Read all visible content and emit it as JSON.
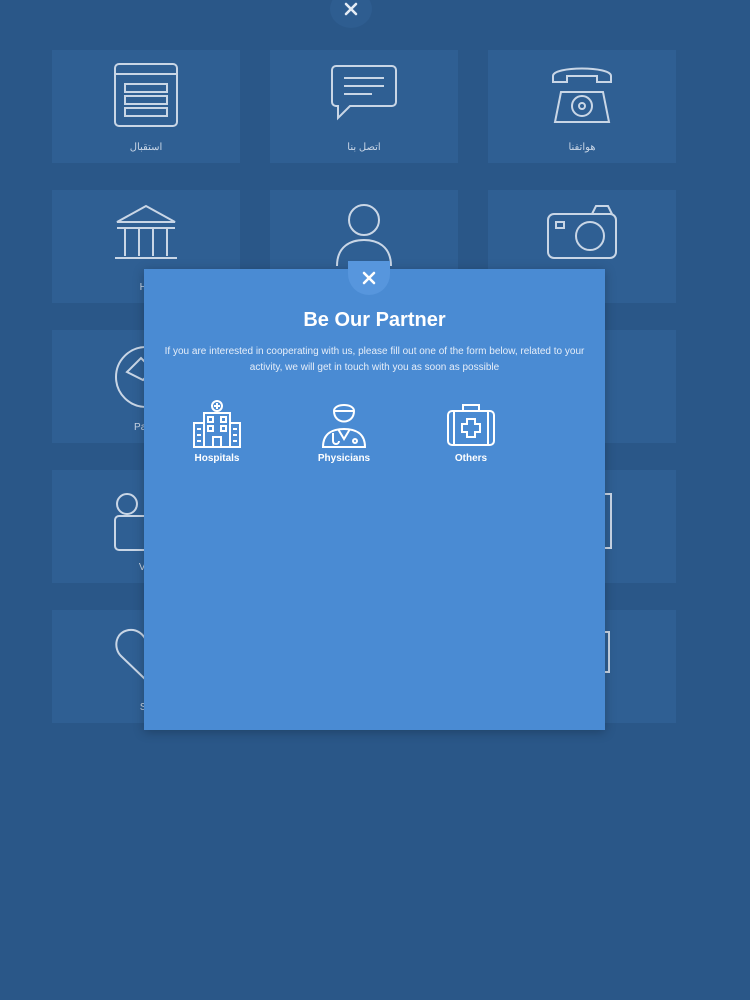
{
  "background_tiles": [
    {
      "label": "استقبال",
      "icon": "reception-icon"
    },
    {
      "label": "اتصل بنا",
      "icon": "chat-icon"
    },
    {
      "label": "هواتفنا",
      "icon": "telephone-icon"
    },
    {
      "label": "Ho",
      "icon": "building-icon"
    },
    {
      "label": "",
      "icon": "person-icon"
    },
    {
      "label": "",
      "icon": "camera-icon"
    },
    {
      "label": "Partn",
      "icon": "handshake-icon"
    },
    {
      "label": "",
      "icon": "tile-icon"
    },
    {
      "label": "",
      "icon": "tile-icon"
    },
    {
      "label": "Vid",
      "icon": "video-icon"
    },
    {
      "label": "",
      "icon": "tile-icon"
    },
    {
      "label": "",
      "icon": "tile-icon"
    },
    {
      "label": "Sa",
      "icon": "heart-icon"
    },
    {
      "label": "",
      "icon": "tile-icon"
    },
    {
      "label": "",
      "icon": "tile-icon"
    }
  ],
  "modal": {
    "title": "Be Our Partner",
    "description": "If you are interested in cooperating with us, please fill out one of the form below, related to your activity, we will get in touch with you as soon as possible",
    "options": [
      {
        "label": "Hospitals",
        "icon": "hospital-icon"
      },
      {
        "label": "Physicians",
        "icon": "physician-icon"
      },
      {
        "label": "Others",
        "icon": "medical-kit-icon"
      }
    ]
  },
  "colors": {
    "background": "#2a5788",
    "tile": "#2f5f93",
    "modal": "#4a8bd3",
    "text_light": "#ffffff"
  }
}
